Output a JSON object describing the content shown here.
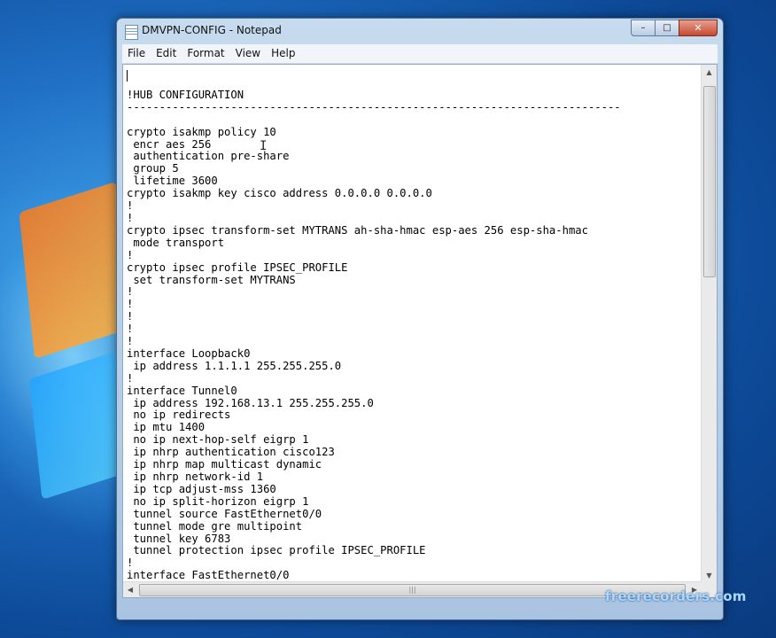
{
  "window": {
    "title": "DMVPN-CONFIG - Notepad",
    "icon": "notepad-icon"
  },
  "controls": {
    "minimize": "–",
    "maximize": "□",
    "close": "✕"
  },
  "menu": {
    "items": [
      "File",
      "Edit",
      "Format",
      "View",
      "Help"
    ]
  },
  "editor": {
    "lines": [
      "",
      "!HUB CONFIGURATION",
      "----------------------------------------------------------------------------",
      "",
      "crypto isakmp policy 10",
      " encr aes 256",
      " authentication pre-share",
      " group 5",
      " lifetime 3600",
      "crypto isakmp key cisco address 0.0.0.0 0.0.0.0",
      "!",
      "!",
      "crypto ipsec transform-set MYTRANS ah-sha-hmac esp-aes 256 esp-sha-hmac",
      " mode transport",
      "!",
      "crypto ipsec profile IPSEC_PROFILE",
      " set transform-set MYTRANS",
      "!",
      "!",
      "!",
      "!",
      "!",
      "interface Loopback0",
      " ip address 1.1.1.1 255.255.255.0",
      "!",
      "interface Tunnel0",
      " ip address 192.168.13.1 255.255.255.0",
      " no ip redirects",
      " ip mtu 1400",
      " no ip next-hop-self eigrp 1",
      " ip nhrp authentication cisco123",
      " ip nhrp map multicast dynamic",
      " ip nhrp network-id 1",
      " ip tcp adjust-mss 1360",
      " no ip split-horizon eigrp 1",
      " tunnel source FastEthernet0/0",
      " tunnel mode gre multipoint",
      " tunnel key 6783",
      " tunnel protection ipsec profile IPSEC_PROFILE",
      "!",
      "interface FastEthernet0/0"
    ]
  },
  "scrollbars": {
    "up": "▲",
    "down": "▼",
    "left": "◀",
    "right": "▶",
    "grip": "|||"
  },
  "watermark": "freerecorders.com",
  "colors": {
    "desktop": "#1f6fc4",
    "window_frame": "#b9cfe8",
    "close_button": "#c44a30"
  }
}
